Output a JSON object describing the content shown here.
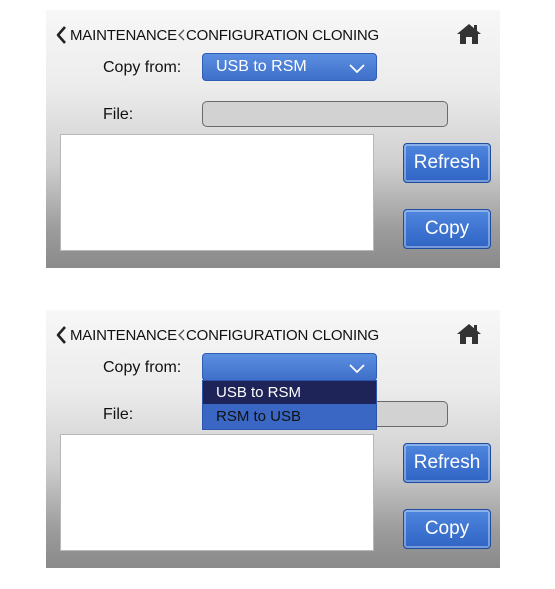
{
  "screens": [
    {
      "breadcrumb": {
        "parent": "MAINTENANCE",
        "current": "CONFIGURATION CLONING"
      },
      "copy_from_label": "Copy from:",
      "copy_from_value": "USB to RSM",
      "file_label": "File:",
      "file_value": "",
      "refresh_label": "Refresh",
      "copy_label": "Copy",
      "dropdown_open": false
    },
    {
      "breadcrumb": {
        "parent": "MAINTENANCE",
        "current": "CONFIGURATION CLONING"
      },
      "copy_from_label": "Copy from:",
      "copy_from_value": "",
      "file_label": "File:",
      "file_value": "",
      "refresh_label": "Refresh",
      "copy_label": "Copy",
      "dropdown_open": true,
      "dropdown_options": [
        "USB to RSM",
        "RSM to USB"
      ],
      "selected_option": "USB to RSM"
    }
  ],
  "icons": {
    "back": "chevron-left-icon",
    "home": "home-icon",
    "dropdown": "chevron-down-icon"
  },
  "colors": {
    "accent": "#3f6fca",
    "selected_option": "#1e2458"
  }
}
